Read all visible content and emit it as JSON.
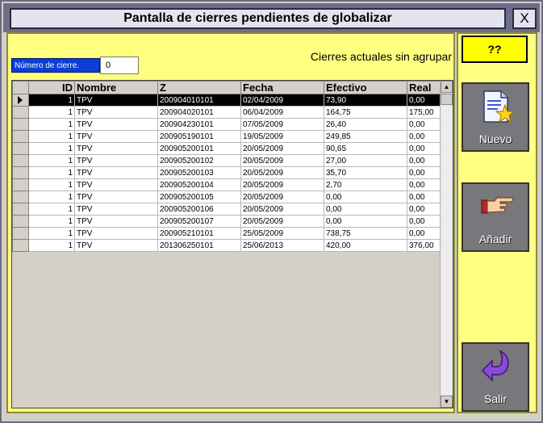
{
  "window": {
    "title": "Pantalla de cierres pendientes de globalizar",
    "close_label": "X"
  },
  "form": {
    "num_label": "Número de cierre.",
    "num_value": "0",
    "caption": "Cierres actuales sin agrupar"
  },
  "table": {
    "columns": [
      "ID",
      "Nombre",
      "Z",
      "Fecha",
      "Efectivo",
      "Real"
    ],
    "rows": [
      [
        "1",
        "TPV",
        "200904010101",
        "02/04/2009",
        "73,90",
        "0,00"
      ],
      [
        "1",
        "TPV",
        "200904020101",
        "06/04/2009",
        "164,75",
        "175,00"
      ],
      [
        "1",
        "TPV",
        "200904230101",
        "07/05/2009",
        "26,40",
        "0,00"
      ],
      [
        "1",
        "TPV",
        "200905190101",
        "19/05/2009",
        "249,85",
        "0,00"
      ],
      [
        "1",
        "TPV",
        "200905200101",
        "20/05/2009",
        "90,65",
        "0,00"
      ],
      [
        "1",
        "TPV",
        "200905200102",
        "20/05/2009",
        "27,00",
        "0,00"
      ],
      [
        "1",
        "TPV",
        "200905200103",
        "20/05/2009",
        "35,70",
        "0,00"
      ],
      [
        "1",
        "TPV",
        "200905200104",
        "20/05/2009",
        "2,70",
        "0,00"
      ],
      [
        "1",
        "TPV",
        "200905200105",
        "20/05/2009",
        "0,00",
        "0,00"
      ],
      [
        "1",
        "TPV",
        "200905200106",
        "20/05/2009",
        "0,00",
        "0,00"
      ],
      [
        "1",
        "TPV",
        "200905200107",
        "20/05/2009",
        "0,00",
        "0,00"
      ],
      [
        "1",
        "TPV",
        "200905210101",
        "25/05/2009",
        "738,75",
        "0,00"
      ],
      [
        "1",
        "TPV",
        "201306250101",
        "25/06/2013",
        "420,00",
        "376,00"
      ]
    ],
    "selected_row": 0
  },
  "sidebar": {
    "help_label": "??",
    "nuevo_label": "Nuevo",
    "anadir_label": "Añadir",
    "salir_label": "Salir",
    "icons": [
      "new-document-icon",
      "pointing-hand-icon",
      "return-arrow-icon"
    ]
  },
  "colors": {
    "accent_yellow": "#ffff80",
    "label_blue": "#0b3fd6",
    "selected_row": "#000000"
  }
}
